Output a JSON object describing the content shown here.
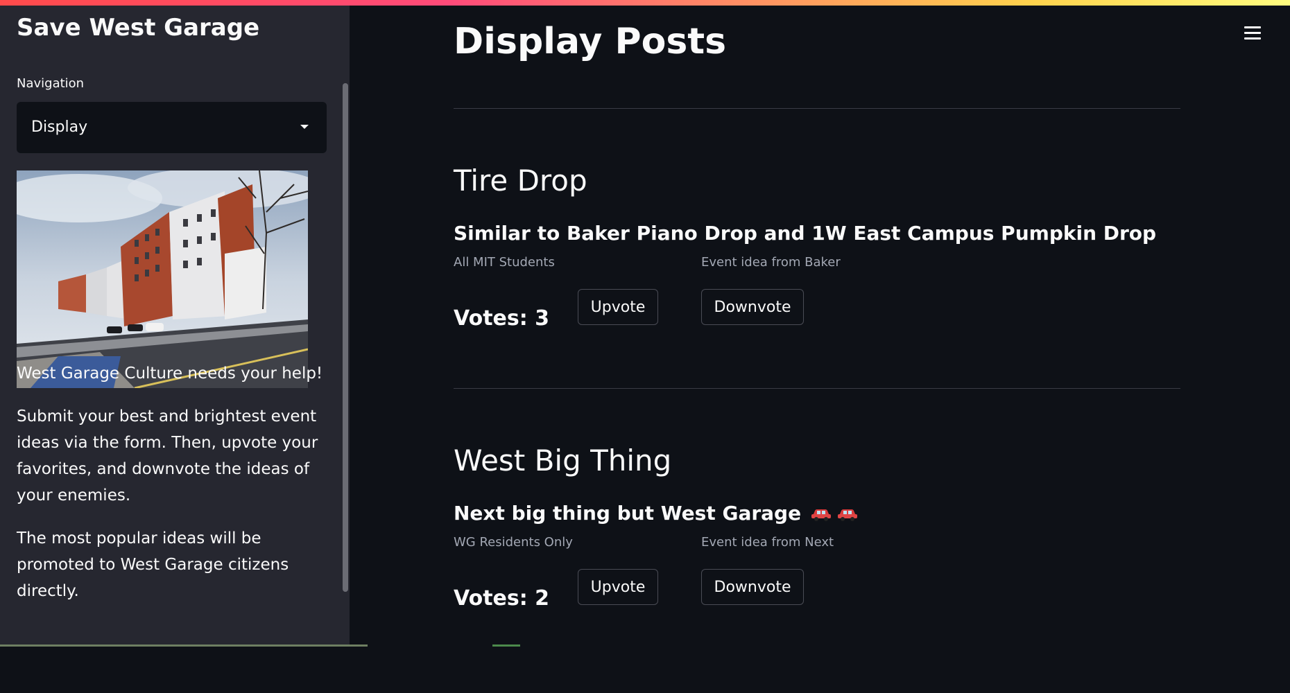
{
  "sidebar": {
    "title": "Save West Garage",
    "nav_label": "Navigation",
    "nav_selected": "Display",
    "intro": "West Garage Culture needs your help!",
    "instructions": "Submit your best and brightest event ideas via the form. Then, upvote your favorites, and downvote the ideas of your enemies.",
    "promotion": "The most popular ideas will be promoted to West Garage citizens directly.",
    "photo_icon": "west-garage-building-photo"
  },
  "main": {
    "title": "Display Posts",
    "menu_icon": "hamburger-menu-icon",
    "posts": [
      {
        "title": "Tire Drop",
        "description": "Similar to Baker Piano Drop and 1W East Campus Pumpkin Drop",
        "audience": "All MIT Students",
        "source": "Event idea from Baker",
        "votes_label": "Votes: 3",
        "upvote_label": "Upvote",
        "downvote_label": "Downvote"
      },
      {
        "title": "West Big Thing",
        "description": "Next big thing but West Garage",
        "description_emoji": "car-emoji car-emoji",
        "audience": "WG Residents Only",
        "source": "Event idea from Next",
        "votes_label": "Votes: 2",
        "upvote_label": "Upvote",
        "downvote_label": "Downvote"
      }
    ]
  },
  "colors": {
    "background": "#0e1117",
    "sidebar": "#262730",
    "text": "#fafafa",
    "muted_text": "#a3a8b4",
    "accent": "#ff4b4b"
  }
}
